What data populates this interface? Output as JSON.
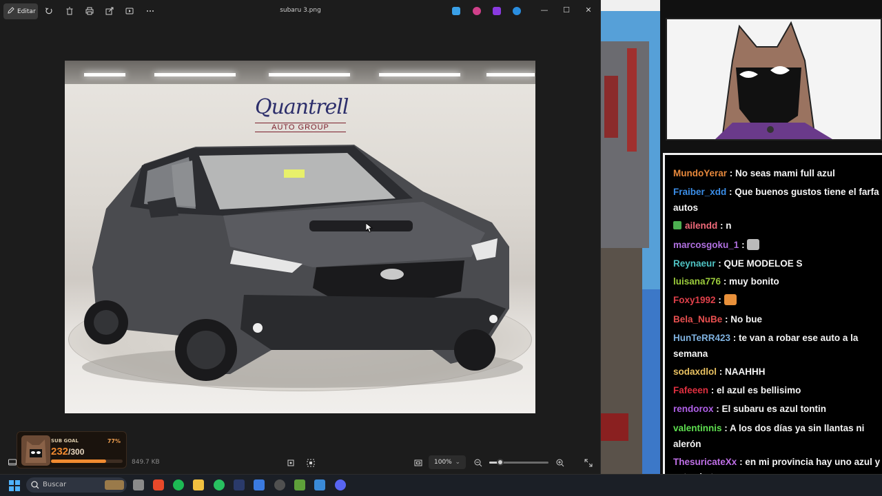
{
  "photos_app": {
    "edit_label": "Editar",
    "file_name": "subaru 3.png",
    "zoom_level": "100%",
    "file_size": "849.7 KB"
  },
  "image": {
    "logo_main": "Quantrell",
    "logo_sub": "AUTO GROUP"
  },
  "sub_goal": {
    "label": "SUB GOAL",
    "current": "232",
    "total": "/300",
    "percent": "77%",
    "progress": 0.77
  },
  "taskbar": {
    "search_placeholder": "Buscar"
  },
  "chat": {
    "messages": [
      {
        "user": "MundoYerar",
        "color": "#e8893c",
        "text": ": No seas mami full azul",
        "badge": false
      },
      {
        "user": "Fraiber_xdd",
        "color": "#3b8ee8",
        "text": ": Que buenos gustos tiene el farfa",
        "badge": false
      },
      {
        "user": "",
        "color": "#f5f5f5",
        "text": "autos",
        "badge": false
      },
      {
        "user": "ailendd",
        "color": "#f06a7a",
        "text": ": n",
        "badge": true
      },
      {
        "user": "marcosgoku_1",
        "color": "#b070e0",
        "text": ":",
        "badge": false,
        "emote": "#bbbbbb"
      },
      {
        "user": "Reynaeur",
        "color": "#4fc3c3",
        "text": ": QUE MODELOE S",
        "badge": false
      },
      {
        "user": "luisana776",
        "color": "#9ccc3c",
        "text": ": muy bonito",
        "badge": false
      },
      {
        "user": "Foxy1992",
        "color": "#e0404a",
        "text": ":",
        "badge": false,
        "emote": "#e8903a"
      },
      {
        "user": "Bela_NuBe",
        "color": "#e85050",
        "text": ": No bue",
        "badge": false
      },
      {
        "user": "HunTeRR423",
        "color": "#7fb2e0",
        "text": ": te van a robar ese auto a la",
        "badge": false
      },
      {
        "user": "",
        "color": "#f5f5f5",
        "text": "semana",
        "badge": false
      },
      {
        "user": "sodaxdlol",
        "color": "#e8c060",
        "text": ": NAAHHH",
        "badge": false
      },
      {
        "user": "Fafeeen",
        "color": "#e03040",
        "text": ": el azul es bellisimo",
        "badge": false
      },
      {
        "user": "rendorox",
        "color": "#b060e8",
        "text": ": El subaru es azul tontin",
        "badge": false
      },
      {
        "user": "valentinnis",
        "color": "#5ee050",
        "text": ": A los dos días ya sin llantas ni",
        "badge": false
      },
      {
        "user": "",
        "color": "#f5f5f5",
        "text": "alerón",
        "badge": false
      },
      {
        "user": "ThesuricateXx",
        "color": "#c070e8",
        "text": ": en mi provincia hay uno azul y",
        "badge": false
      },
      {
        "user": "",
        "color": "#f5f5f5",
        "text": "esta chetooo",
        "badge": false
      }
    ]
  },
  "colors": {
    "accent": "#f08a30",
    "window_bg": "#1c1c1c",
    "chat_bg": "#000000"
  }
}
